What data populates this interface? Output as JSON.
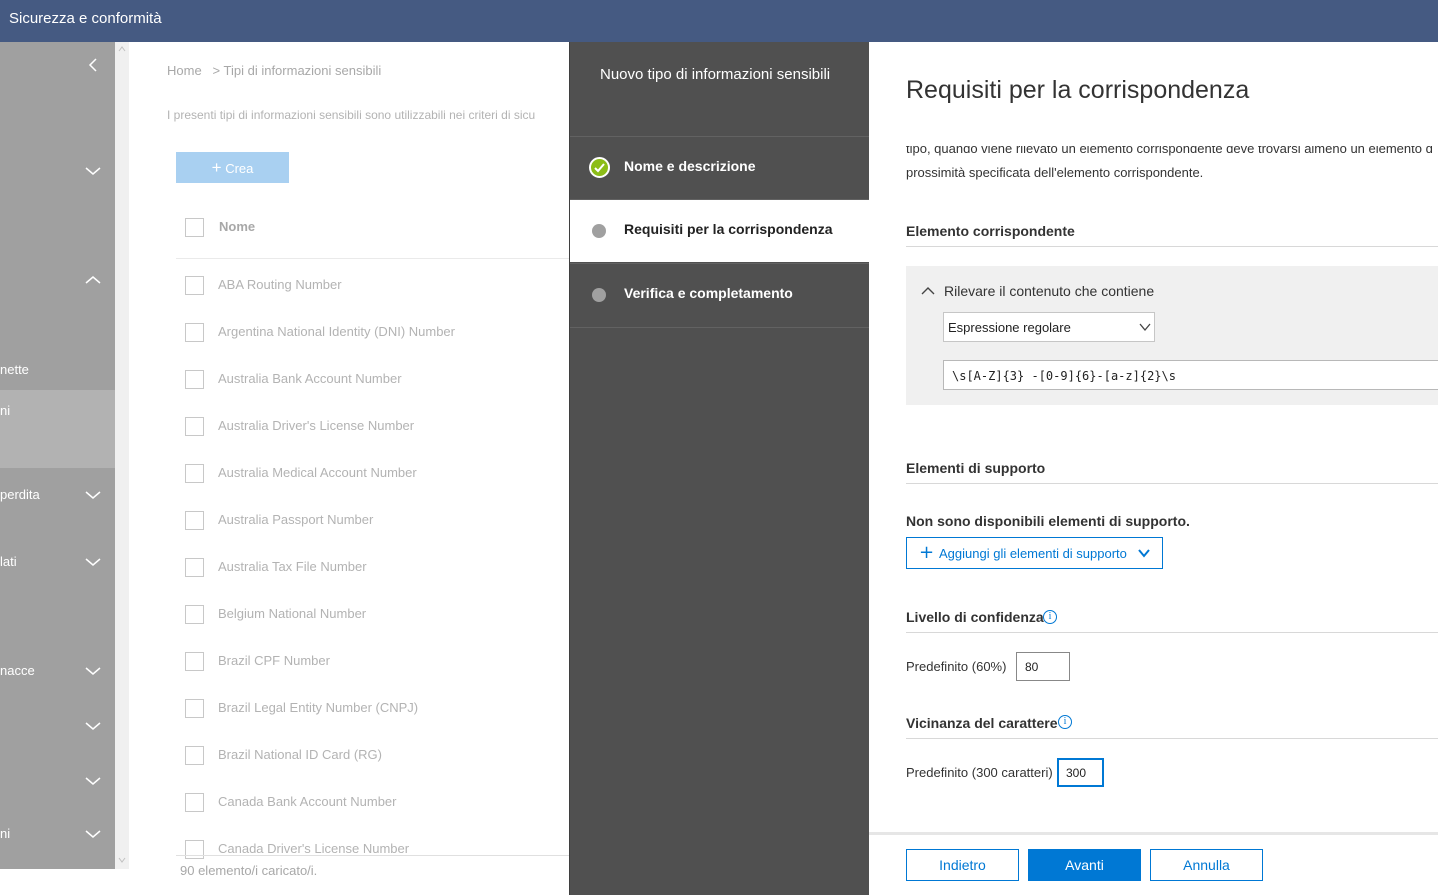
{
  "app": {
    "title": "Sicurezza e conformità"
  },
  "leftnav": {
    "items": [
      {
        "label": "nette",
        "top": 0
      },
      {
        "label": "ni",
        "top": 0
      },
      {
        "label": "perdita",
        "top": 0
      },
      {
        "label": "lati",
        "top": 0
      },
      {
        "label": "nacce",
        "top": 0
      },
      {
        "label": "ni",
        "top": 0
      }
    ]
  },
  "background": {
    "breadcrumb_home": "Home",
    "breadcrumb_sep": ">",
    "breadcrumb_current": "Tipi di informazioni sensibili",
    "description": "I presenti tipi di informazioni sensibili sono utilizzabili nei criteri di sicu",
    "create_label": "Crea",
    "column_name": "Nome",
    "rows": [
      "ABA Routing Number",
      "Argentina National Identity (DNI) Number",
      "Australia Bank Account Number",
      "Australia Driver's License Number",
      "Australia Medical Account Number",
      "Australia Passport Number",
      "Australia Tax File Number",
      "Belgium National Number",
      "Brazil CPF Number",
      "Brazil Legal Entity Number (CNPJ)",
      "Brazil National ID Card (RG)",
      "Canada Bank Account Number",
      "Canada Driver's License Number"
    ],
    "count": "90 elemento/i caricato/i."
  },
  "wizard": {
    "title": "Nuovo tipo di informazioni sensibili",
    "steps": [
      {
        "label": "Nome e descrizione",
        "state": "done"
      },
      {
        "label": "Requisiti per la corrispondenza",
        "state": "current"
      },
      {
        "label": "Verifica e completamento",
        "state": "pending"
      }
    ]
  },
  "main": {
    "title": "Requisiti per la corrispondenza",
    "intro_line1": "tipo, quando viene rilevato un elemento corrispondente deve trovarsi almeno un elemento d",
    "intro_line2": "prossimità specificata dell'elemento corrispondente.",
    "matching": {
      "title": "Elemento corrispondente",
      "detect_label": "Rilevare il contenuto che contiene",
      "type_value": "Espressione regolare",
      "regex_value": "\\s[A-Z]{3} -[0-9]{6}-[a-z]{2}\\s"
    },
    "supporting": {
      "title": "Elementi di supporto",
      "none_text": "Non sono disponibili elementi di supporto.",
      "add_label": "Aggiungi gli elementi di supporto"
    },
    "confidence": {
      "title": "Livello di confidenza",
      "default_label": "Predefinito (60%)",
      "value": "80"
    },
    "proximity": {
      "title": "Vicinanza del carattere",
      "default_label": "Predefinito (300 caratteri)",
      "value": "300"
    }
  },
  "footer": {
    "back": "Indietro",
    "next": "Avanti",
    "cancel": "Annulla"
  },
  "colors": {
    "topbar": "#455a82",
    "accent": "#0078d4",
    "step_done": "#8cbd18",
    "wizard_bg": "#505050"
  }
}
